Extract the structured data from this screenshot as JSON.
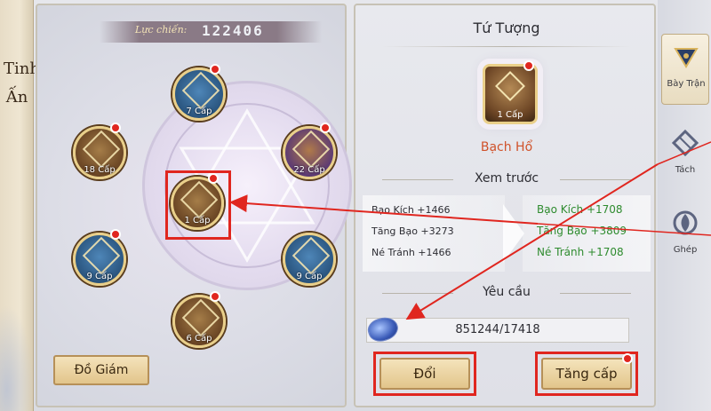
{
  "title_strip": {
    "text_line1": "Tinh",
    "text_line2": "Ấn"
  },
  "power": {
    "label": "Lực chiến:",
    "value": "122406"
  },
  "nodes": [
    {
      "id": "top",
      "level": "7 Cấp"
    },
    {
      "id": "upper-left",
      "level": "18 Cấp"
    },
    {
      "id": "upper-right",
      "level": "22 Cấp"
    },
    {
      "id": "center",
      "level": "1 Cấp"
    },
    {
      "id": "lower-left",
      "level": "9 Cấp"
    },
    {
      "id": "lower-right",
      "level": "9 Cấp"
    },
    {
      "id": "bottom",
      "level": "6 Cấp"
    }
  ],
  "do_giam_label": "Đồ Giám",
  "right_panel": {
    "title": "Tứ Tượng",
    "preview_level": "1 Cấp",
    "preview_name": "Bạch Hổ",
    "preview_heading": "Xem trước",
    "stats_old": [
      "Bạo Kích +1466",
      "Tăng Bạo +3273",
      "Né Tránh +1466"
    ],
    "stats_new": [
      "Bạo Kích +1708",
      "Tăng Bạo +3809",
      "Né Tránh +1708"
    ],
    "requirement_heading": "Yêu cầu",
    "requirement_value": "851244/17418",
    "exchange_label": "Đổi",
    "upgrade_label": "Tăng cấp"
  },
  "sidebar": {
    "tabs": [
      {
        "label": "Bày Trận",
        "icon": "triangle-formation-icon",
        "active": true
      },
      {
        "label": "Tách",
        "icon": "split-diamond-icon",
        "active": false
      },
      {
        "label": "Ghép",
        "icon": "spiral-merge-icon",
        "active": false
      }
    ]
  },
  "colors": {
    "highlight_red": "#e0261f",
    "stat_green": "#2e8b2e",
    "name_orange": "#d0522a",
    "button_gold": "#e2c58b"
  }
}
